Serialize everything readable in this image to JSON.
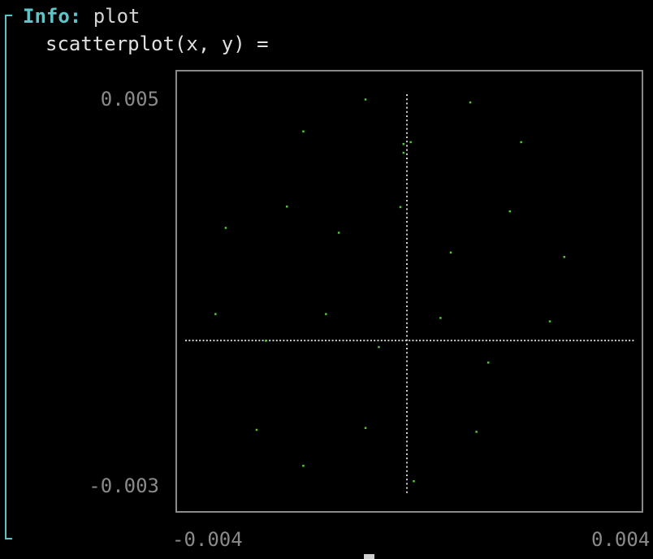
{
  "terminal": {
    "info_label": "Info:",
    "info_text": " plot",
    "expression": "scatterplot(x, y) ="
  },
  "colors": {
    "accent": "#5ec4c8",
    "points": "#4fc832",
    "axes": "#cfcfcf",
    "frame": "#8a8a8a"
  },
  "chart_data": {
    "type": "scatter",
    "title": "",
    "xlabel": "",
    "ylabel": "",
    "xlim": [
      -0.004,
      0.004
    ],
    "ylim": [
      -0.003,
      0.005
    ],
    "xlim_labels": [
      "-0.004",
      "0.004"
    ],
    "ylim_labels": [
      "0.005",
      "-0.003"
    ],
    "series": [
      {
        "points": [
          {
            "x": -0.00373,
            "y": 0.00055
          },
          {
            "x": -0.00353,
            "y": 0.00233
          },
          {
            "x": -0.00293,
            "y": -0.00184
          },
          {
            "x": -0.00275,
            "y": 0.0
          },
          {
            "x": -0.00202,
            "y": 0.00432
          },
          {
            "x": -0.00234,
            "y": 0.00277
          },
          {
            "x": -0.00202,
            "y": -0.00258
          },
          {
            "x": -0.00158,
            "y": 0.00055
          },
          {
            "x": -0.00133,
            "y": 0.00223
          },
          {
            "x": -0.00081,
            "y": 0.00498
          },
          {
            "x": -0.00081,
            "y": -0.0018
          },
          {
            "x": -0.00055,
            "y": -0.00013
          },
          {
            "x": -0.00013,
            "y": 0.00276
          },
          {
            "x": -7e-05,
            "y": 0.00388
          },
          {
            "x": -7e-05,
            "y": 0.00406
          },
          {
            "x": 7e-05,
            "y": 0.0041
          },
          {
            "x": 0.00013,
            "y": -0.0029
          },
          {
            "x": 0.00065,
            "y": 0.00047
          },
          {
            "x": 0.00085,
            "y": 0.00182
          },
          {
            "x": 0.00123,
            "y": 0.00492
          },
          {
            "x": 0.00135,
            "y": -0.00188
          },
          {
            "x": 0.00158,
            "y": -0.00045
          },
          {
            "x": 0.002,
            "y": 0.00267
          },
          {
            "x": 0.00222,
            "y": 0.0041
          },
          {
            "x": 0.00278,
            "y": 0.0004
          },
          {
            "x": 0.00306,
            "y": 0.00173
          }
        ]
      }
    ],
    "grid": false,
    "legend": "none",
    "axis_lines": {
      "x": 0,
      "y": 0
    }
  }
}
